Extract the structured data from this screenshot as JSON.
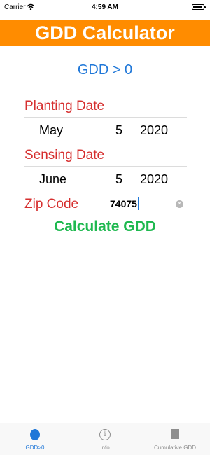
{
  "status_bar": {
    "carrier": "Carrier",
    "time": "4:59 AM"
  },
  "header": {
    "title": "GDD Calculator",
    "background_color": "#ff8c00"
  },
  "mode_label": "GDD > 0",
  "planting": {
    "label": "Planting Date",
    "month": "May",
    "day": "5",
    "year": "2020"
  },
  "sensing": {
    "label": "Sensing Date",
    "month": "June",
    "day": "5",
    "year": "2020"
  },
  "zip": {
    "label": "Zip Code",
    "value": "74075"
  },
  "calculate_label": "Calculate GDD",
  "tabs": [
    {
      "label": "GDD>0",
      "icon": "circle-icon",
      "selected": true
    },
    {
      "label": "Info",
      "icon": "info-icon",
      "selected": false
    },
    {
      "label": "Cumulative GDD",
      "icon": "square-icon",
      "selected": false
    }
  ],
  "colors": {
    "accent": "#1f77d8",
    "label_red": "#d62f2f",
    "button_green": "#1fb950"
  }
}
